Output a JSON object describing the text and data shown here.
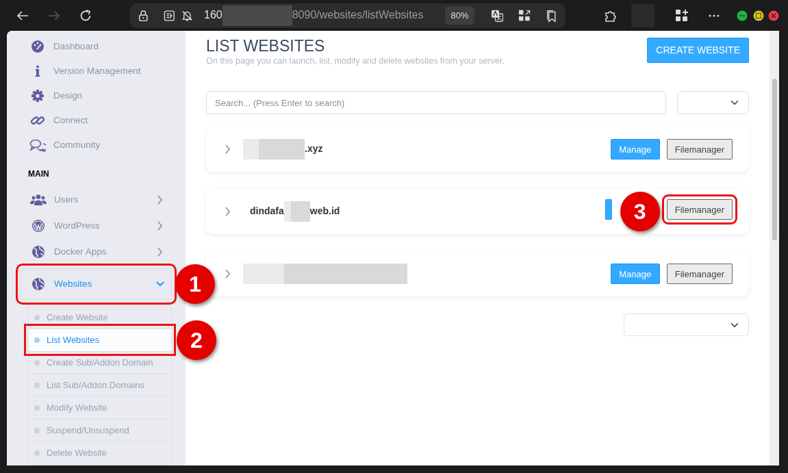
{
  "browser": {
    "nav_buttons": [
      {
        "disabled": false
      },
      {
        "disabled": true
      },
      {
        "disabled": false
      }
    ],
    "url": [
      {
        "kind": "text",
        "text": "160"
      },
      {
        "kind": "redacted"
      },
      {
        "kind": "text",
        "text": "8090/websites/listWebsites"
      }
    ],
    "zoom": "80%"
  },
  "sidebar": {
    "items": [
      {
        "label": "Dashboard",
        "selected": false
      },
      {
        "label": "Version Management",
        "selected": false
      },
      {
        "label": "Design",
        "selected": false
      },
      {
        "label": "Connect",
        "selected": false
      },
      {
        "label": "Community",
        "selected": false
      }
    ],
    "sections": [
      {
        "title": "MAIN",
        "items": [
          {
            "label": "Users",
            "expanded": false,
            "selected": false
          },
          {
            "label": "WordPress",
            "expanded": false,
            "selected": false
          },
          {
            "label": "Docker Apps",
            "expanded": false,
            "selected": false
          },
          {
            "label": "Websites",
            "expanded": true,
            "selected": true,
            "callout": "1",
            "children": [
              {
                "label": "Create Website",
                "selected": false
              },
              {
                "label": "List Websites",
                "selected": true,
                "callout": "2"
              },
              {
                "label": "Create Sub/Addon Domain",
                "selected": false
              },
              {
                "label": "List Sub/Addon Domains",
                "selected": false
              },
              {
                "label": "Modify Website",
                "selected": false
              },
              {
                "label": "Suspend/Unsuspend",
                "selected": false
              },
              {
                "label": "Delete Website",
                "selected": false
              }
            ]
          }
        ]
      }
    ]
  },
  "main": {
    "title": "LIST WEBSITES",
    "subtitle": "On this page you can launch, list, modify and delete websites from your server.",
    "create_button": "CREATE WEBSITE",
    "search": {
      "placeholder": "Search... (Press Enter to search)"
    },
    "websites": [
      {
        "expanded": false,
        "name": [
          {
            "kind": "redacted"
          },
          {
            "kind": "text",
            "text": ".xyz"
          }
        ],
        "buttons": [
          {
            "kind": "primary",
            "label": "Manage"
          },
          {
            "kind": "secondary",
            "label": "Filemanager"
          }
        ]
      },
      {
        "expanded": false,
        "name": [
          {
            "kind": "text",
            "text": "dindafa"
          },
          {
            "kind": "redacted"
          },
          {
            "kind": "text",
            "text": "web.id"
          }
        ],
        "buttons": [
          {
            "kind": "primary"
          },
          {
            "kind": "secondary",
            "label": "Filemanager",
            "callout": "3"
          }
        ]
      },
      {
        "expanded": false,
        "name": [
          {
            "kind": "redacted"
          }
        ],
        "buttons": [
          {
            "kind": "primary",
            "label": "Manage"
          },
          {
            "kind": "secondary",
            "label": "Filemanager"
          }
        ]
      }
    ]
  }
}
